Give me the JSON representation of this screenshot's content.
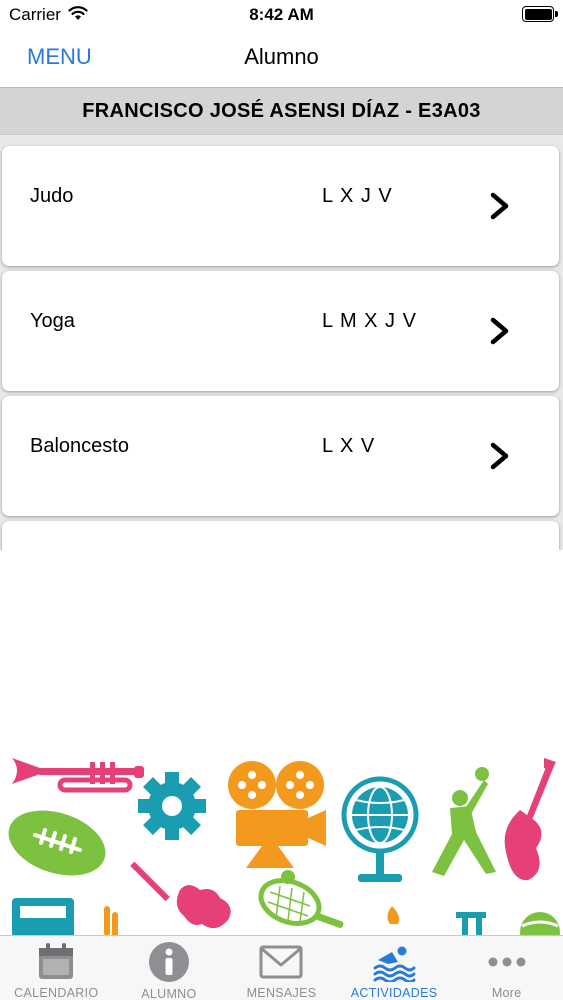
{
  "status_bar": {
    "carrier": "Carrier",
    "time": "8:42 AM"
  },
  "nav": {
    "menu_label": "MENU",
    "title": "Alumno"
  },
  "student": {
    "banner": "FRANCISCO JOSÉ ASENSI DÍAZ - E3A03"
  },
  "activities": [
    {
      "name": "Judo",
      "days": "L X J V"
    },
    {
      "name": "Yoga",
      "days": "L M X J V"
    },
    {
      "name": "Baloncesto",
      "days": "L X V"
    }
  ],
  "tabs": [
    {
      "label": "CALENDARIO",
      "icon": "calendar-icon",
      "active": false
    },
    {
      "label": "ALUMNO",
      "icon": "info-icon",
      "active": false
    },
    {
      "label": "MENSAJES",
      "icon": "mail-icon",
      "active": false
    },
    {
      "label": "ACTIVIDADES",
      "icon": "swimmer-icon",
      "active": true
    },
    {
      "label": "More",
      "icon": "more-icon",
      "active": false
    }
  ],
  "colors": {
    "accent": "#2a7ad8",
    "inactive_tab": "#8e8e93",
    "banner_bg": "#d4d4d4"
  }
}
